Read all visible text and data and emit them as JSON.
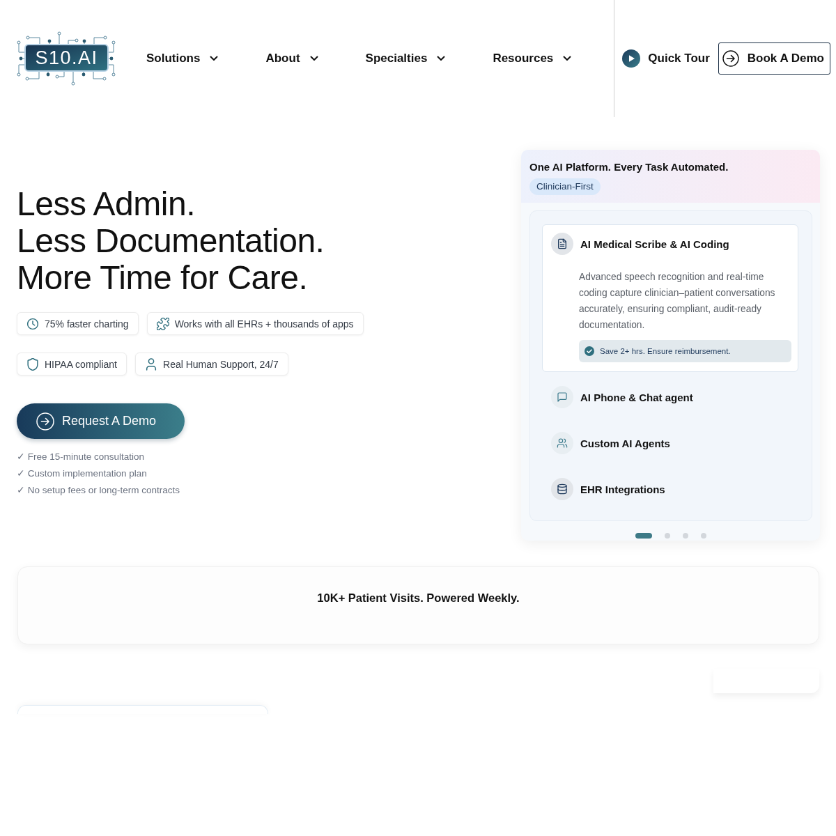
{
  "header": {
    "logo": {
      "text": "S10.AI"
    },
    "nav": [
      {
        "label": "Solutions",
        "dropdown": true
      },
      {
        "label": "About",
        "dropdown": true
      },
      {
        "label": "Specialties",
        "dropdown": true
      },
      {
        "label": "Resources",
        "dropdown": true
      }
    ],
    "quick_tour": {
      "label": "Quick Tour"
    },
    "book_demo": {
      "label": "Book A Demo"
    }
  },
  "hero": {
    "headline": [
      "Less Admin.",
      "Less Documentation.",
      "More Time for Care."
    ],
    "badges": [
      {
        "label": "75% faster charting"
      },
      {
        "label": "Works with all EHRs + thousands of apps"
      },
      {
        "label": "HIPAA compliant"
      },
      {
        "label": "Real Human Support, 24/7"
      }
    ],
    "cta": {
      "label": "Request A Demo"
    },
    "checklist": [
      "✓ Free 15-minute consultation",
      "✓ Custom implementation plan",
      "✓ No setup fees or long-term contracts"
    ]
  },
  "platform_card": {
    "title": "One AI Platform. Every Task Automated.",
    "tag": "Clinician-First",
    "features": [
      {
        "title": "AI Medical Scribe & AI Coding",
        "expanded": true,
        "description": "Advanced speech recognition and real-time coding capture clinician–patient conversations accurately, ensuring compliant, audit-ready documentation.",
        "benefit": "Save 2+ hrs. Ensure reimbursement."
      },
      {
        "title": "AI Phone & Chat agent",
        "expanded": false
      },
      {
        "title": "Custom AI Agents",
        "expanded": false
      },
      {
        "title": "EHR Integrations",
        "expanded": false
      }
    ],
    "pager": [
      {
        "selected": true
      },
      {
        "selected": false
      },
      {
        "selected": false
      },
      {
        "selected": false
      }
    ]
  },
  "stats_banner": {
    "text": "10K+ Patient Visits. Powered Weekly."
  }
}
